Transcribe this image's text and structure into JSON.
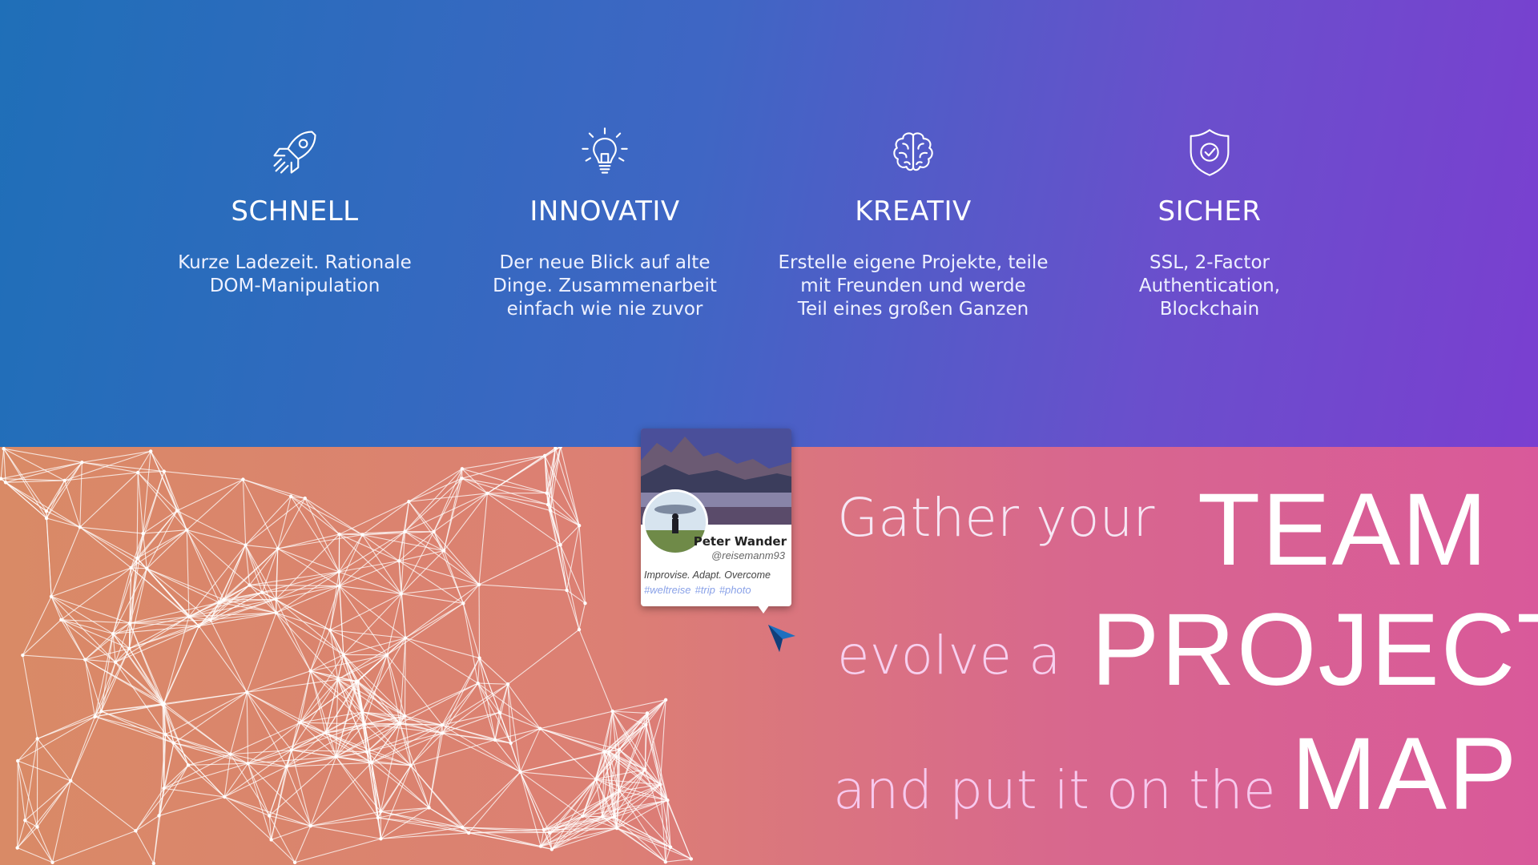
{
  "features": [
    {
      "icon": "rocket-icon",
      "title": "SCHNELL",
      "lines": [
        "Kurze Ladezeit. Rationale",
        "DOM-Manipulation",
        ""
      ]
    },
    {
      "icon": "lightbulb-icon",
      "title": "INNOVATIV",
      "lines": [
        "Der neue Blick auf alte",
        "Dinge. Zusammenarbeit",
        "einfach wie nie zuvor"
      ]
    },
    {
      "icon": "brain-icon",
      "title": "KREATIV",
      "lines": [
        "Erstelle eigene Projekte, teile",
        "mit Freunden und werde",
        "Teil eines großen Ganzen"
      ]
    },
    {
      "icon": "shield-check-icon",
      "title": "SICHER",
      "lines": [
        "SSL, 2-Factor",
        "Authentication,",
        "Blockchain"
      ]
    }
  ],
  "hero": {
    "line1_small": "Gather your",
    "line1_big": "TEAM",
    "line2_small": "evolve a",
    "line2_big": "PROJECT",
    "line3_small": "and put it on the",
    "line3_big": "MAP"
  },
  "profile_card": {
    "name": "Peter Wander",
    "handle": "@reisemanm93",
    "motto": "Improvise. Adapt. Overcome",
    "tags": [
      "#weltreise",
      "#trip",
      "#photo"
    ]
  },
  "colors": {
    "top_gradient_start": "#1f6fb8",
    "top_gradient_end": "#7a3fd0",
    "bottom_gradient_start": "#d98a66",
    "bottom_gradient_end": "#d9599a",
    "hashtag": "#8aa2e8"
  },
  "icons": [
    "rocket-icon",
    "lightbulb-icon",
    "brain-icon",
    "shield-check-icon",
    "network-graphic",
    "map-pin-cursor-icon"
  ]
}
